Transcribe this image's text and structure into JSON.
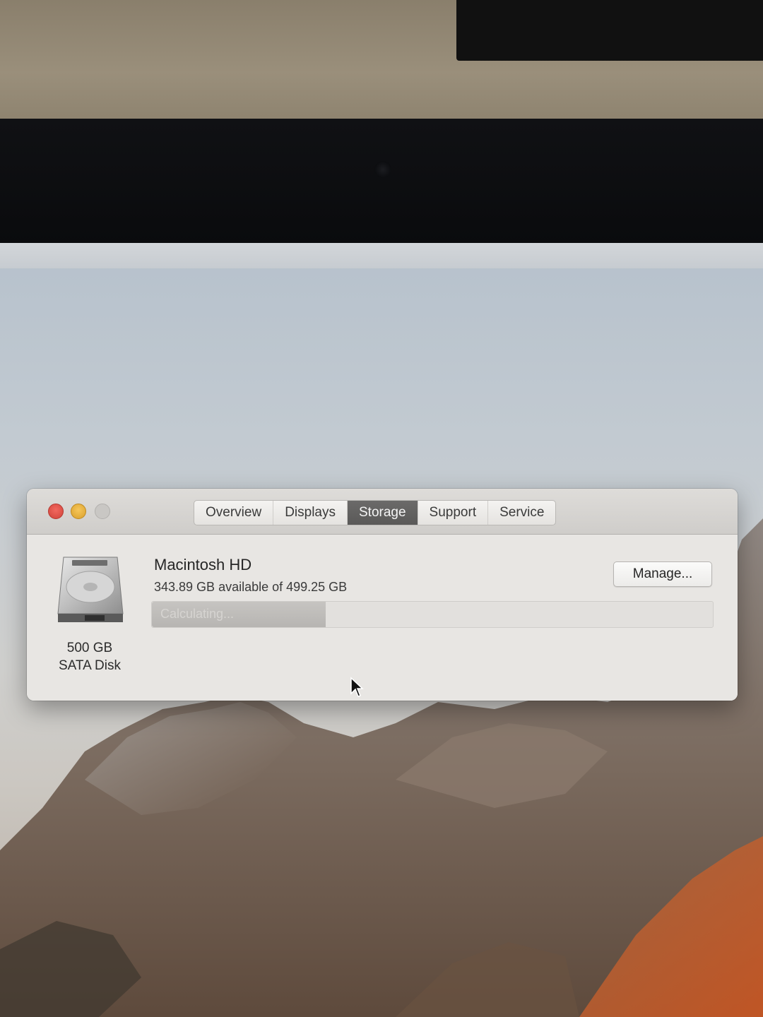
{
  "window": {
    "tabs": [
      {
        "label": "Overview",
        "active": false
      },
      {
        "label": "Displays",
        "active": false
      },
      {
        "label": "Storage",
        "active": true
      },
      {
        "label": "Support",
        "active": false
      },
      {
        "label": "Service",
        "active": false
      }
    ],
    "traffic_lights": {
      "close_color": "#e0554c",
      "minimize_color": "#e8b23f",
      "zoom_color": "#c9c7c4"
    }
  },
  "storage": {
    "disk": {
      "icon": "hard-disk-icon",
      "capacity": "500 GB",
      "type": "SATA Disk"
    },
    "volume": {
      "name": "Macintosh HD",
      "available": "343.89 GB available of 499.25 GB"
    },
    "usage_bar": {
      "label": "Calculating...",
      "fill_fraction": 0.31
    },
    "manage_label": "Manage..."
  },
  "colors": {
    "active_tab": "#5f5e5d",
    "window_bg": "#e8e6e3"
  }
}
